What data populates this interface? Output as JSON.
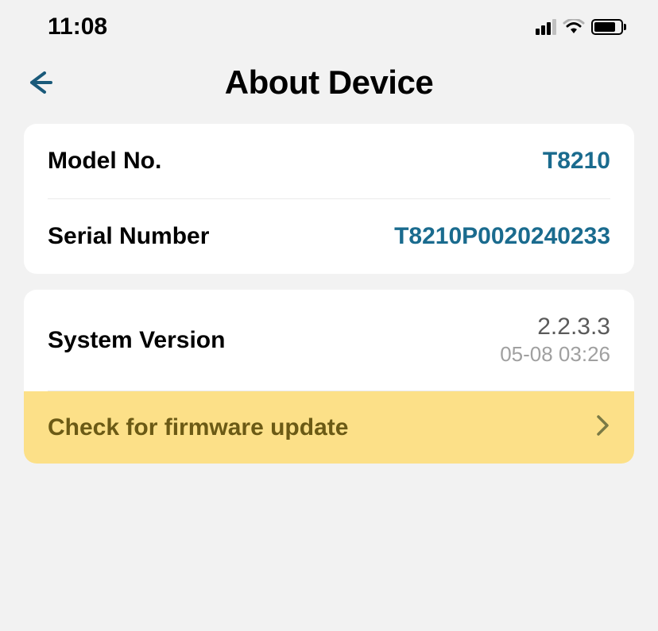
{
  "status_bar": {
    "time": "11:08"
  },
  "header": {
    "title": "About Device"
  },
  "device_info": {
    "model": {
      "label": "Model No.",
      "value": "T8210"
    },
    "serial": {
      "label": "Serial Number",
      "value": "T8210P0020240233"
    }
  },
  "system": {
    "version": {
      "label": "System Version",
      "value": "2.2.3.3",
      "date": "05-08 03:26"
    },
    "update": {
      "label": "Check for firmware update"
    }
  }
}
